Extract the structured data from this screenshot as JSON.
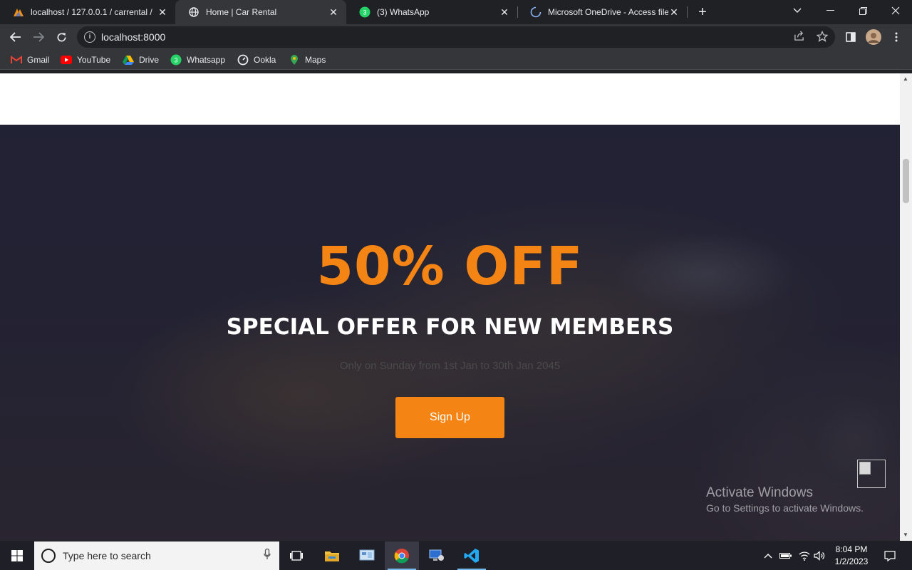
{
  "browser": {
    "tabs": [
      {
        "title": "localhost / 127.0.0.1 / carrental /",
        "icon": "phpmyadmin-icon"
      },
      {
        "title": "Home | Car Rental",
        "icon": "globe-icon"
      },
      {
        "title": "(3) WhatsApp",
        "icon": "whatsapp-icon",
        "badge": "3"
      },
      {
        "title": "Microsoft OneDrive - Access files",
        "icon": "loading-spinner-icon"
      }
    ],
    "active_tab_index": 1,
    "address": "localhost:8000",
    "bookmarks": [
      {
        "label": "Gmail",
        "icon": "gmail-icon"
      },
      {
        "label": "YouTube",
        "icon": "youtube-icon"
      },
      {
        "label": "Drive",
        "icon": "drive-icon"
      },
      {
        "label": "Whatsapp",
        "icon": "whatsapp-icon",
        "badge": "3"
      },
      {
        "label": "Ookla",
        "icon": "ookla-icon"
      },
      {
        "label": "Maps",
        "icon": "maps-icon"
      }
    ]
  },
  "page": {
    "offer": {
      "headline": "50% OFF",
      "subheadline": "SPECIAL OFFER FOR NEW MEMBERS",
      "note": "Only on Sunday from 1st Jan to 30th Jan 2045",
      "button_label": "Sign Up"
    },
    "watermark": {
      "line1": "Activate Windows",
      "line2": "Go to Settings to activate Windows."
    },
    "colors": {
      "accent": "#f48414",
      "overlay": "#1c1c30"
    }
  },
  "taskbar": {
    "search_placeholder": "Type here to search",
    "apps": [
      "file-explorer-icon",
      "control-panel-icon",
      "chrome-icon",
      "remote-desktop-icon",
      "vscode-icon"
    ],
    "time": "8:04 PM",
    "date": "1/2/2023"
  }
}
